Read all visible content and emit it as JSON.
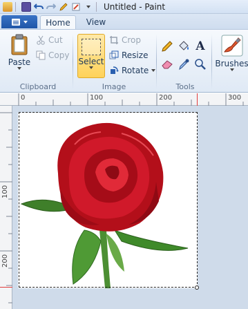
{
  "window": {
    "title": "Untitled - Paint"
  },
  "quick_access": {
    "icons": [
      "paint-app-icon",
      "save-icon",
      "undo-icon",
      "redo-icon",
      "pencil-icon",
      "brush-icon",
      "dropdown-icon"
    ]
  },
  "tabs": [
    {
      "label": "Home",
      "active": true
    },
    {
      "label": "View",
      "active": false
    }
  ],
  "ribbon": {
    "clipboard": {
      "group_label": "Clipboard",
      "paste_label": "Paste",
      "cut_label": "Cut",
      "copy_label": "Copy"
    },
    "image": {
      "group_label": "Image",
      "select_label": "Select",
      "crop_label": "Crop",
      "resize_label": "Resize",
      "rotate_label": "Rotate"
    },
    "tools": {
      "group_label": "Tools",
      "items": [
        "pencil-icon",
        "fill-icon",
        "text-icon",
        "eraser-icon",
        "color-picker-icon",
        "magnifier-icon"
      ],
      "text_glyph": "A"
    },
    "brushes": {
      "label": "Brushes"
    }
  },
  "rulers": {
    "top": [
      "0",
      "100",
      "200",
      "300"
    ],
    "left": [
      "100",
      "200"
    ]
  },
  "colors": {
    "accent": "#1f56a8",
    "selected_button": "#ffd25a",
    "workspace_bg": "#cfdbea",
    "rose": "#c5121f",
    "leaf": "#3f8a2a"
  }
}
